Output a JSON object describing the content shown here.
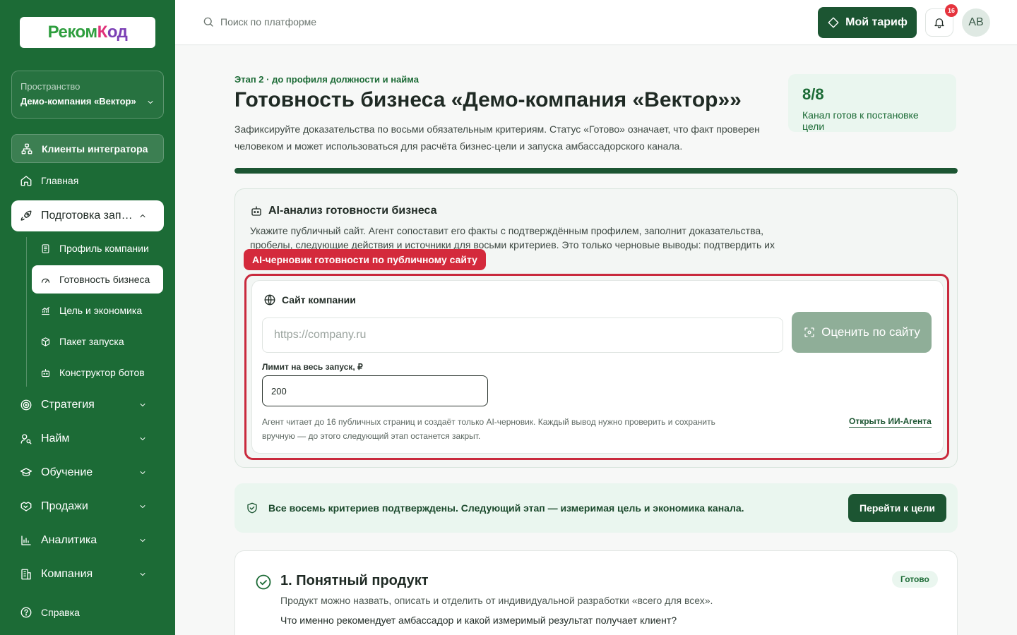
{
  "sidebar": {
    "logo": {
      "part1": "Реком",
      "part2": "К",
      "part3": "од"
    },
    "space": {
      "label": "Пространство",
      "name": "Демо-компания «Вектор»"
    },
    "clients": "Клиенты интегратора",
    "home": "Главная",
    "prep": "Подготовка запуска",
    "sub": {
      "profile": "Профиль компании",
      "readiness": "Готовность бизнеса",
      "goal": "Цель и экономика",
      "package": "Пакет запуска",
      "bots": "Конструктор ботов"
    },
    "strategy": "Стратегия",
    "hiring": "Найм",
    "training": "Обучение",
    "sales": "Продажи",
    "analytics": "Аналитика",
    "company": "Компания",
    "help": "Справка"
  },
  "header": {
    "search_placeholder": "Поиск по платформе",
    "tariff": "Мой тариф",
    "notifications": "16",
    "avatar": "AB"
  },
  "page": {
    "stage": "Этап 2 · до профиля должности и найма",
    "title": "Готовность бизнеса «Демо-компания «Вектор»»",
    "description": "Зафиксируйте доказательства по восьми обязательным критериям. Статус «Готово» означает, что факт проверен человеком и может использоваться для расчёта бизнес-цели и запуска амбассадорского канала.",
    "score": "8/8",
    "score_label": "Канал готов к постановке цели",
    "progress": 1.0
  },
  "ai": {
    "title": "AI-анализ готовности бизнеса",
    "description": "Укажите публичный сайт. Агент сопоставит его факты с подтверждённым профилем, заполнит доказательства, пробелы, следующие действия и источники для восьми критериев. Это только черновые выводы: подтвердить их",
    "tag": "AI-черновик готовности по публичному сайту",
    "site_title": "Сайт компании",
    "url_placeholder": "https://company.ru",
    "evaluate": "Оценить по сайту",
    "limit_label": "Лимит на весь запуск, ₽",
    "limit_value": "200",
    "note": "Агент читает до 16 публичных страниц и создаёт только AI-черновик. Каждый вывод нужно проверить и сохранить вручную — до этого следующий этап останется закрыт.",
    "open_agent": "Открыть ИИ-Агента"
  },
  "confirm": {
    "text": "Все восемь критериев подтверждены. Следующий этап — измеримая цель и экономика канала.",
    "button": "Перейти к цели"
  },
  "criterion": {
    "title": "1. Понятный продукт",
    "status": "Готово",
    "description": "Продукт можно назвать, описать и отделить от индивидуальной разработки «всего для всех».",
    "question": "Что именно рекомендует амбассадор и какой измеримый результат получает клиент?"
  },
  "colors": {
    "brand": "#1c6b36",
    "dark": "#1c5532",
    "alert": "#d42a3c"
  }
}
